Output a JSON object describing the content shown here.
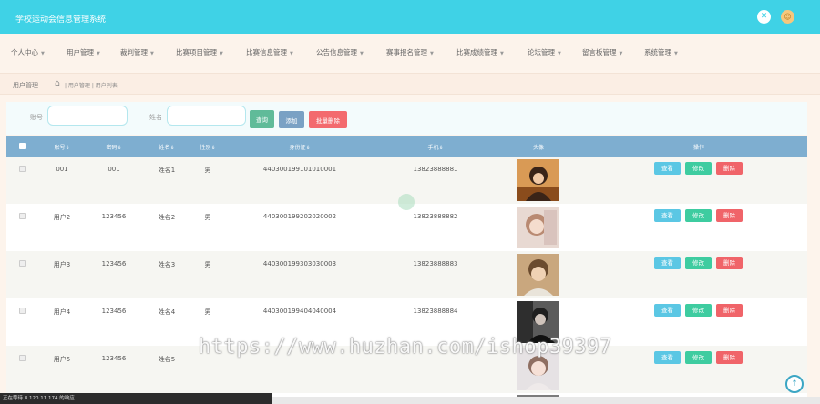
{
  "app": {
    "title": "学校运动会信息管理系统",
    "icons": [
      "settings-icon",
      "user-avatar-icon"
    ]
  },
  "nav": [
    {
      "label": "个人中心"
    },
    {
      "label": "用户管理"
    },
    {
      "label": "裁判管理"
    },
    {
      "label": "比赛项目管理"
    },
    {
      "label": "比赛信息管理"
    },
    {
      "label": "公告信息管理"
    },
    {
      "label": "赛事报名管理"
    },
    {
      "label": "比赛成绩管理"
    },
    {
      "label": "论坛管理"
    },
    {
      "label": "留言板管理"
    },
    {
      "label": "系统管理"
    }
  ],
  "breadcrumb": {
    "title": "用户管理",
    "path": "| 用户管理 | 用户列表"
  },
  "search": {
    "account_label": "账号",
    "account_value": "",
    "name_label": "姓名",
    "name_value": "",
    "query_button": "查询",
    "add_button": "添加",
    "batch_delete_button": "批量删除"
  },
  "table": {
    "headers": [
      "账号",
      "密码",
      "姓名",
      "性别",
      "身份证",
      "手机",
      "头像",
      "操作"
    ],
    "rows": [
      {
        "account": "001",
        "password": "001",
        "name": "姓名1",
        "gender": "男",
        "id_card": "440300199101010001",
        "phone": "13823888881",
        "avatar": "avatar-1"
      },
      {
        "account": "用户2",
        "password": "123456",
        "name": "姓名2",
        "gender": "男",
        "id_card": "440300199202020002",
        "phone": "13823888882",
        "avatar": "avatar-2"
      },
      {
        "account": "用户3",
        "password": "123456",
        "name": "姓名3",
        "gender": "男",
        "id_card": "440300199303030003",
        "phone": "13823888883",
        "avatar": "avatar-3"
      },
      {
        "account": "用户4",
        "password": "123456",
        "name": "姓名4",
        "gender": "男",
        "id_card": "440300199404040004",
        "phone": "13823888884",
        "avatar": "avatar-4"
      },
      {
        "account": "用户5",
        "password": "123456",
        "name": "姓名5",
        "gender": "",
        "id_card": "",
        "phone": "",
        "avatar": "avatar-5"
      }
    ],
    "actions": {
      "view": "查看",
      "edit": "修改",
      "delete": "删除"
    }
  },
  "watermark": "https://www.huzhan.com/ishop39397",
  "status_bar": "正在等待 8.120.11.174 的响应...",
  "colors": {
    "header": "#3fd2e6",
    "table_header": "#7eaed0",
    "view": "#5bc7e4",
    "edit": "#3ecca0",
    "delete": "#f06469"
  }
}
